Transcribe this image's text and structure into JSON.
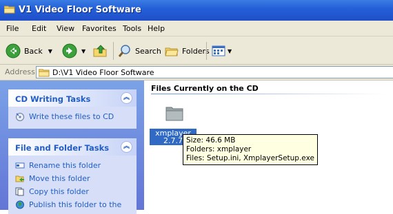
{
  "window": {
    "title": "V1 Video Floor Software"
  },
  "menu": [
    "File",
    "Edit",
    "View",
    "Favorites",
    "Tools",
    "Help"
  ],
  "toolbar": {
    "back_label": "Back",
    "search_label": "Search",
    "folders_label": "Folders"
  },
  "address": {
    "label": "Address",
    "path": "D:\\V1 Video Floor Software"
  },
  "tasks": {
    "cd_writing": {
      "header": "CD Writing Tasks",
      "items": [
        "Write these files to CD"
      ]
    },
    "file_folder": {
      "header": "File and Folder Tasks",
      "items": [
        "Rename this folder",
        "Move this folder",
        "Copy this folder",
        "Publish this folder to the"
      ]
    }
  },
  "content": {
    "section_title": "Files Currently on the CD",
    "item": {
      "name_line1": "xmplayer",
      "name_line2": "2.7.7"
    }
  },
  "tooltip": {
    "size": "Size: 46.6 MB",
    "folders": "Folders: xmplayer",
    "files": "Files: Setup.ini, XmplayerSetup.exe"
  }
}
